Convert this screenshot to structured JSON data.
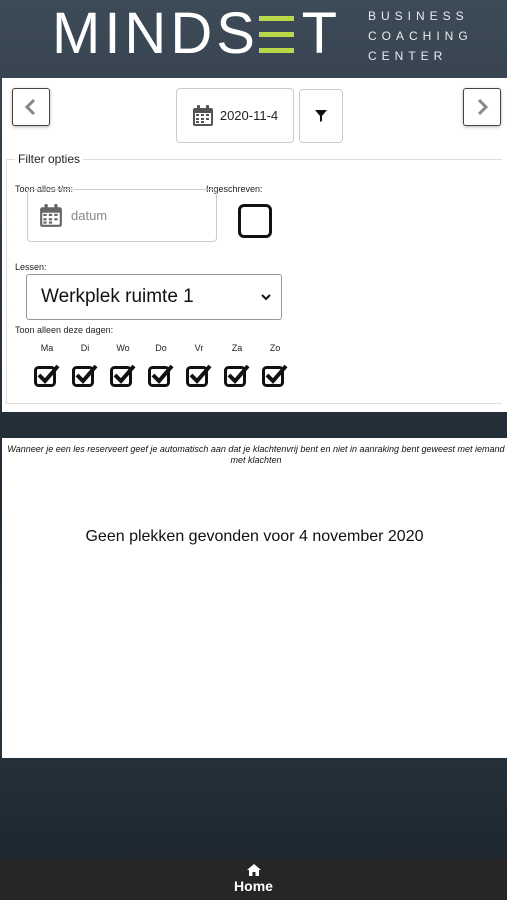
{
  "header": {
    "logo_text_start": "MINDS",
    "logo_text_accent": "E",
    "logo_text_end": "T",
    "logo_sub": [
      "BUSINESS",
      "COACHING",
      "CENTER"
    ],
    "accent_color": "#b9d94a"
  },
  "toolbar": {
    "prev_icon": "chevron-left-icon",
    "next_icon": "chevron-right-icon",
    "date_value": "2020-11-4",
    "calendar_icon": "calendar-icon",
    "filter_icon": "filter-icon"
  },
  "filters": {
    "legend": "Filter opties",
    "show_until_label": "Toon alles t/m:",
    "date_placeholder": "datum",
    "registered_label": "Ingeschreven:",
    "registered_checked": false,
    "lessons_label": "Lessen:",
    "lessons_selected": "Werkplek ruimte 1",
    "days_label": "Toon alleen deze dagen:",
    "days": [
      {
        "label": "Ma",
        "checked": true
      },
      {
        "label": "Di",
        "checked": true
      },
      {
        "label": "Wo",
        "checked": true
      },
      {
        "label": "Do",
        "checked": true
      },
      {
        "label": "Vr",
        "checked": true
      },
      {
        "label": "Za",
        "checked": true
      },
      {
        "label": "Zo",
        "checked": true
      }
    ]
  },
  "content": {
    "notice": "Wanneer je een les reserveert geef je automatisch aan dat je klachtenvrij bent en niet in aanraking bent geweest met iemand met klachten",
    "empty_message": "Geen plekken gevonden voor 4 november 2020"
  },
  "bottom_nav": {
    "home_label": "Home",
    "home_icon": "home-icon"
  }
}
